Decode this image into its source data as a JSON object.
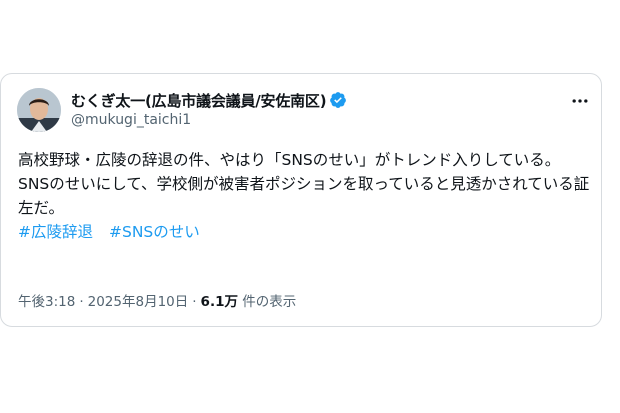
{
  "author": {
    "display_name": "むくぎ太一(広島市議会議員/安佐南区)",
    "handle": "@mukugi_taichi1",
    "avatar_icon": "profile-photo",
    "verified_icon": "verified-badge-icon",
    "verified_color": "#1d9bf0"
  },
  "more_icon": "more-horizontal-icon",
  "tweet": {
    "line1": "高校野球・広陵の辞退の件、やはり「SNSのせい」がトレンド入りしている。",
    "line2": "SNSのせいにして、学校側が被害者ポジションを取っていると見透かされている証左だ。",
    "hashtags": [
      "#広陵辞退",
      "#SNSのせい"
    ]
  },
  "meta": {
    "time": "午後3:18",
    "separator": "·",
    "date": "2025年8月10日",
    "views_count": "6.1万",
    "views_label": "件の表示"
  },
  "colors": {
    "text_primary": "#0f1419",
    "text_secondary": "#536471",
    "link": "#1d9bf0",
    "border": "#d7dbdf"
  }
}
